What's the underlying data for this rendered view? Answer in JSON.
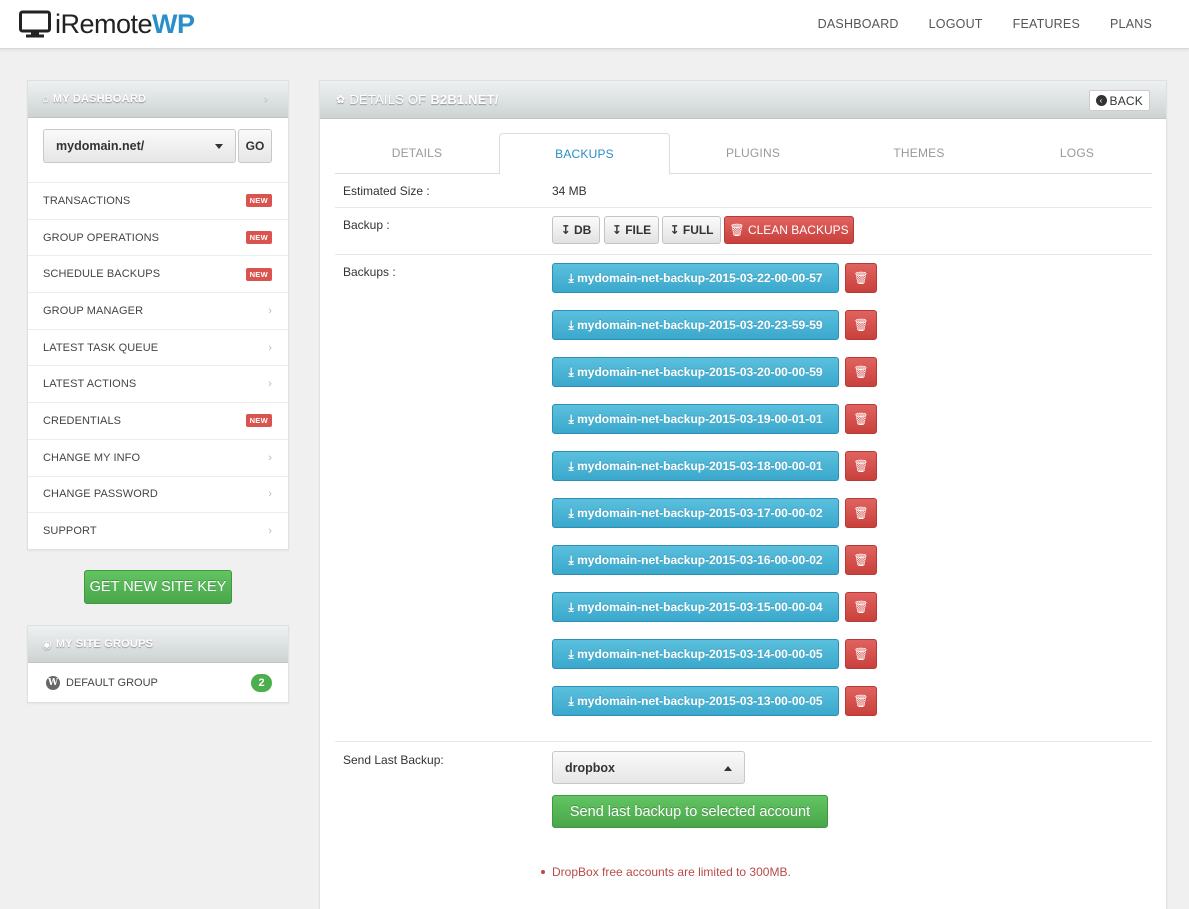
{
  "brand": {
    "prefix": "iRemote",
    "suffix": "WP"
  },
  "topnav": [
    "DASHBOARD",
    "LOGOUT",
    "FEATURES",
    "PLANS"
  ],
  "sidebar": {
    "title": "MY DASHBOARD",
    "chevron": "›",
    "domain_select": "mydomain.net/",
    "go_label": "GO",
    "new_label": "NEW",
    "items": [
      {
        "label": "TRANSACTIONS",
        "badge": "NEW"
      },
      {
        "label": "GROUP OPERATIONS",
        "badge": "NEW"
      },
      {
        "label": "SCHEDULE BACKUPS",
        "badge": "NEW"
      },
      {
        "label": "GROUP MANAGER",
        "badge": ""
      },
      {
        "label": "LATEST TASK QUEUE",
        "badge": ""
      },
      {
        "label": "LATEST ACTIONS",
        "badge": ""
      },
      {
        "label": "CREDENTIALS",
        "badge": "NEW"
      },
      {
        "label": "CHANGE MY INFO",
        "badge": ""
      },
      {
        "label": "CHANGE PASSWORD",
        "badge": ""
      },
      {
        "label": "SUPPORT",
        "badge": ""
      }
    ],
    "site_key_button": "GET NEW SITE KEY"
  },
  "site_groups": {
    "title": "MY SITE GROUPS",
    "groups": [
      {
        "label": "DEFAULT GROUP",
        "count": "2"
      }
    ]
  },
  "main": {
    "title_prefix": "DETAILS OF",
    "title_domain": "B2B1.NET/",
    "back_label": "BACK",
    "tabs": [
      "DETAILS",
      "BACKUPS",
      "PLUGINS",
      "THEMES",
      "LOGS"
    ],
    "active_tab": "BACKUPS",
    "estimated_size_label": "Estimated Size :",
    "estimated_size_value": "34 MB",
    "backup_label": "Backup :",
    "backup_buttons": {
      "db": "DB",
      "file": "FILE",
      "full": "FULL",
      "clean": "CLEAN BACKUPS"
    },
    "backups_label": "Backups :",
    "backups": [
      "mydomain-net-backup-2015-03-22-00-00-57",
      "mydomain-net-backup-2015-03-20-23-59-59",
      "mydomain-net-backup-2015-03-20-00-00-59",
      "mydomain-net-backup-2015-03-19-00-01-01",
      "mydomain-net-backup-2015-03-18-00-00-01",
      "mydomain-net-backup-2015-03-17-00-00-02",
      "mydomain-net-backup-2015-03-16-00-00-02",
      "mydomain-net-backup-2015-03-15-00-00-04",
      "mydomain-net-backup-2015-03-14-00-00-05",
      "mydomain-net-backup-2015-03-13-00-00-05"
    ],
    "send_label": "Send Last Backup:",
    "send_select": "dropbox",
    "send_button": "Send last backup to selected account",
    "note": "DropBox free accounts are limited to 300MB."
  },
  "colors": {
    "accent": "#2a8fc8",
    "success": "#4cae4c",
    "danger": "#d9534f",
    "info": "#5bc0de"
  }
}
